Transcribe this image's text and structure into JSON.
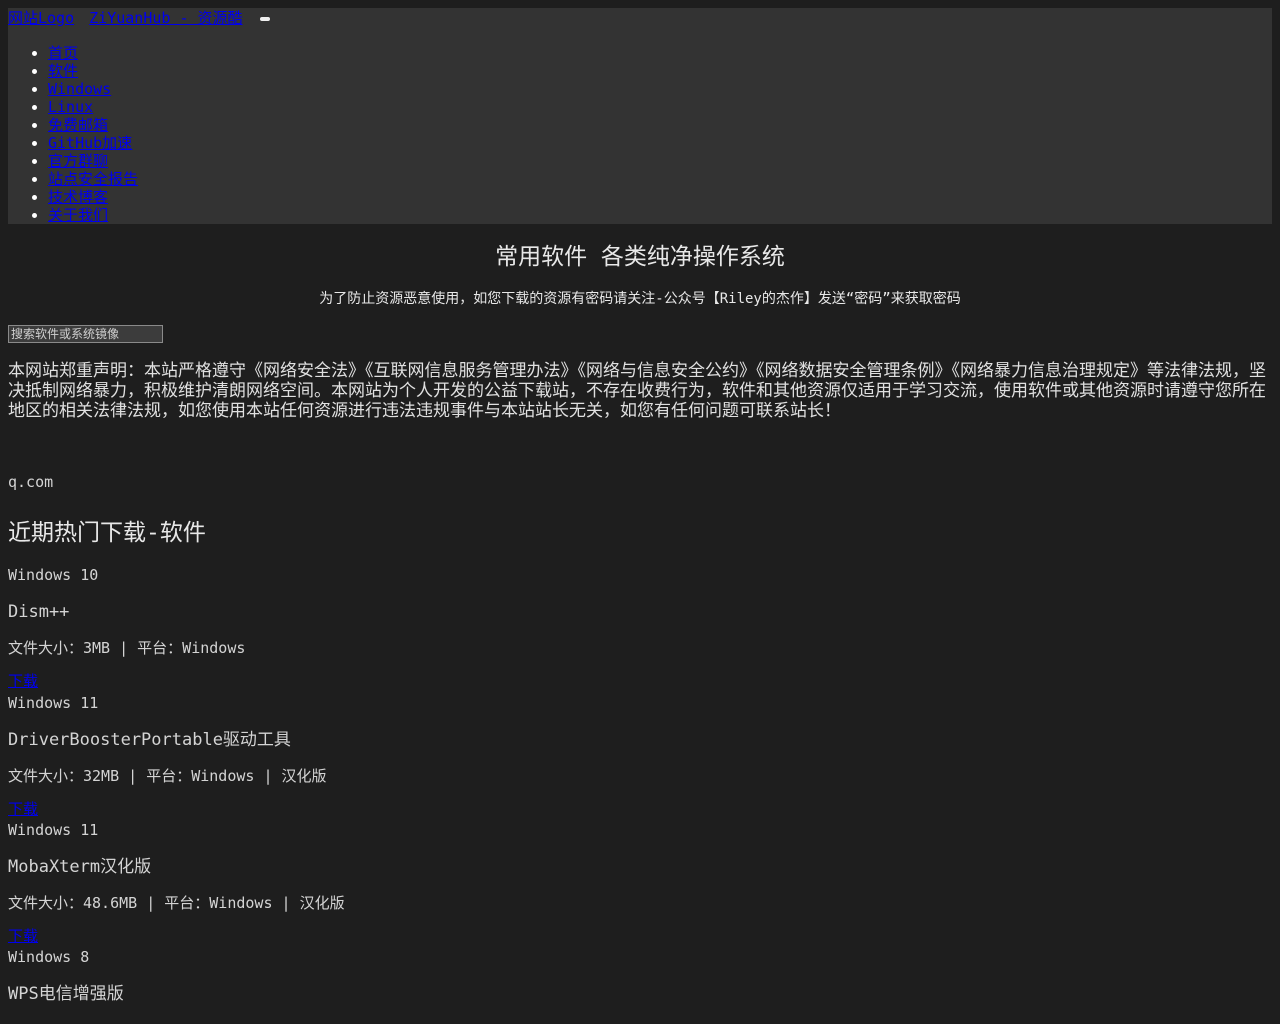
{
  "header": {
    "logo_alt": "网站Logo",
    "site_name": "ZiYuanHub - 资源酷"
  },
  "nav": [
    {
      "label": "首页"
    },
    {
      "label": "软件"
    },
    {
      "label": "Windows"
    },
    {
      "label": "Linux"
    },
    {
      "label": "免费邮箱"
    },
    {
      "label": "GitHub加速"
    },
    {
      "label": "官方群聊"
    },
    {
      "label": "站点安全报告"
    },
    {
      "label": "技术博客"
    },
    {
      "label": "关于我们"
    }
  ],
  "main": {
    "title": "常用软件 各类纯净操作系统",
    "notice": "为了防止资源恶意使用，如您下载的资源有密码请关注-公众号【Riley的杰作】发送“密码”来获取密码",
    "search_placeholder": "搜索软件或系统镜像",
    "disclaimer": "本网站郑重声明：本站严格遵守《网络安全法》《互联网信息服务管理办法》《网络与信息安全公约》《网络数据安全管理条例》《网络暴力信息治理规定》等法律法规，坚决抵制网络暴力，积极维护清朗网络空间。本网站为个人开发的公益下载站，不存在收费行为，软件和其他资源仅适用于学习交流，使用软件或其他资源时请遵守您所在地区的相关法律法规，如您使用本站任何资源进行违法违规事件与本站站长无关，如您有任何问题可联系站长！",
    "domain_text": "q.com"
  },
  "section": {
    "title": "近期热门下载-软件"
  },
  "downloads": [
    {
      "system": "Windows 10",
      "name": "Dism++",
      "meta": "文件大小：3MB | 平台：Windows",
      "download_label": "下载"
    },
    {
      "system": "Windows 11",
      "name": "DriverBoosterPortable驱动工具",
      "meta": "文件大小：32MB | 平台：Windows | 汉化版",
      "download_label": "下载"
    },
    {
      "system": "Windows 11",
      "name": "MobaXterm汉化版",
      "meta": "文件大小：48.6MB | 平台：Windows | 汉化版",
      "download_label": "下载"
    },
    {
      "system": "Windows 8",
      "name": "WPS电信增强版",
      "meta": "",
      "download_label": ""
    }
  ]
}
